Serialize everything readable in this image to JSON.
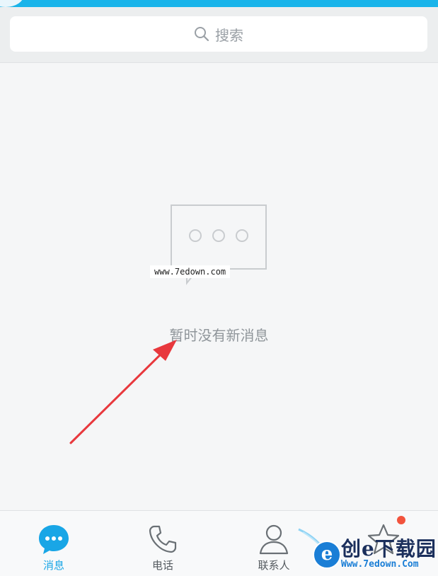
{
  "search": {
    "placeholder": "搜索"
  },
  "empty_state": {
    "message": "暂时没有新消息",
    "watermark": "www.7edown.com"
  },
  "tabs": [
    {
      "label": "消息",
      "icon": "chat-bubble-icon",
      "active": true
    },
    {
      "label": "电话",
      "icon": "phone-icon",
      "active": false
    },
    {
      "label": "联系人",
      "icon": "contacts-icon",
      "active": false
    },
    {
      "label": "",
      "icon": "star-icon",
      "active": false
    }
  ],
  "logo_watermark": {
    "title": "创e下载园",
    "url": "Www.7edown.Com"
  },
  "colors": {
    "accent": "#19b4ea",
    "active_tab": "#19a6e6",
    "badge": "#f2533d",
    "arrow": "#e8383d"
  }
}
